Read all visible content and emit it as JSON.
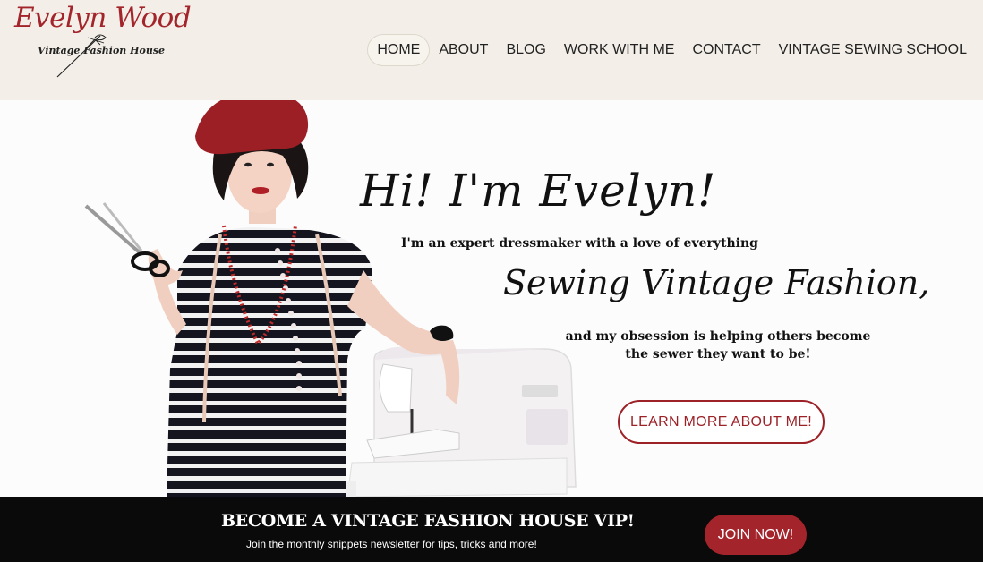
{
  "brand": {
    "name": "Evelyn Wood",
    "tagline": "Vintage Fashion House"
  },
  "nav": {
    "items": [
      {
        "label": "HOME",
        "active": true
      },
      {
        "label": "ABOUT"
      },
      {
        "label": "BLOG"
      },
      {
        "label": "WORK WITH ME"
      },
      {
        "label": "CONTACT"
      },
      {
        "label": "VINTAGE SEWING SCHOOL"
      }
    ]
  },
  "hero": {
    "greeting": "Hi! I'm Evelyn!",
    "intro": "I'm an expert dressmaker with a love of  everything",
    "highlight": "Sewing Vintage Fashion,",
    "mission_line1": "and my obsession is helping others become",
    "mission_line2": "the sewer they want to be!",
    "cta_label": "LEARN MORE ABOUT ME!"
  },
  "vip": {
    "title": "BECOME A VINTAGE FASHION HOUSE VIP!",
    "subtitle": "Join the monthly snippets newsletter for tips, tricks and more!",
    "join_label": "JOIN NOW!"
  },
  "colors": {
    "accent": "#a3242b",
    "header_bg": "#f3efe8",
    "bar_bg": "#0a0a0a"
  }
}
